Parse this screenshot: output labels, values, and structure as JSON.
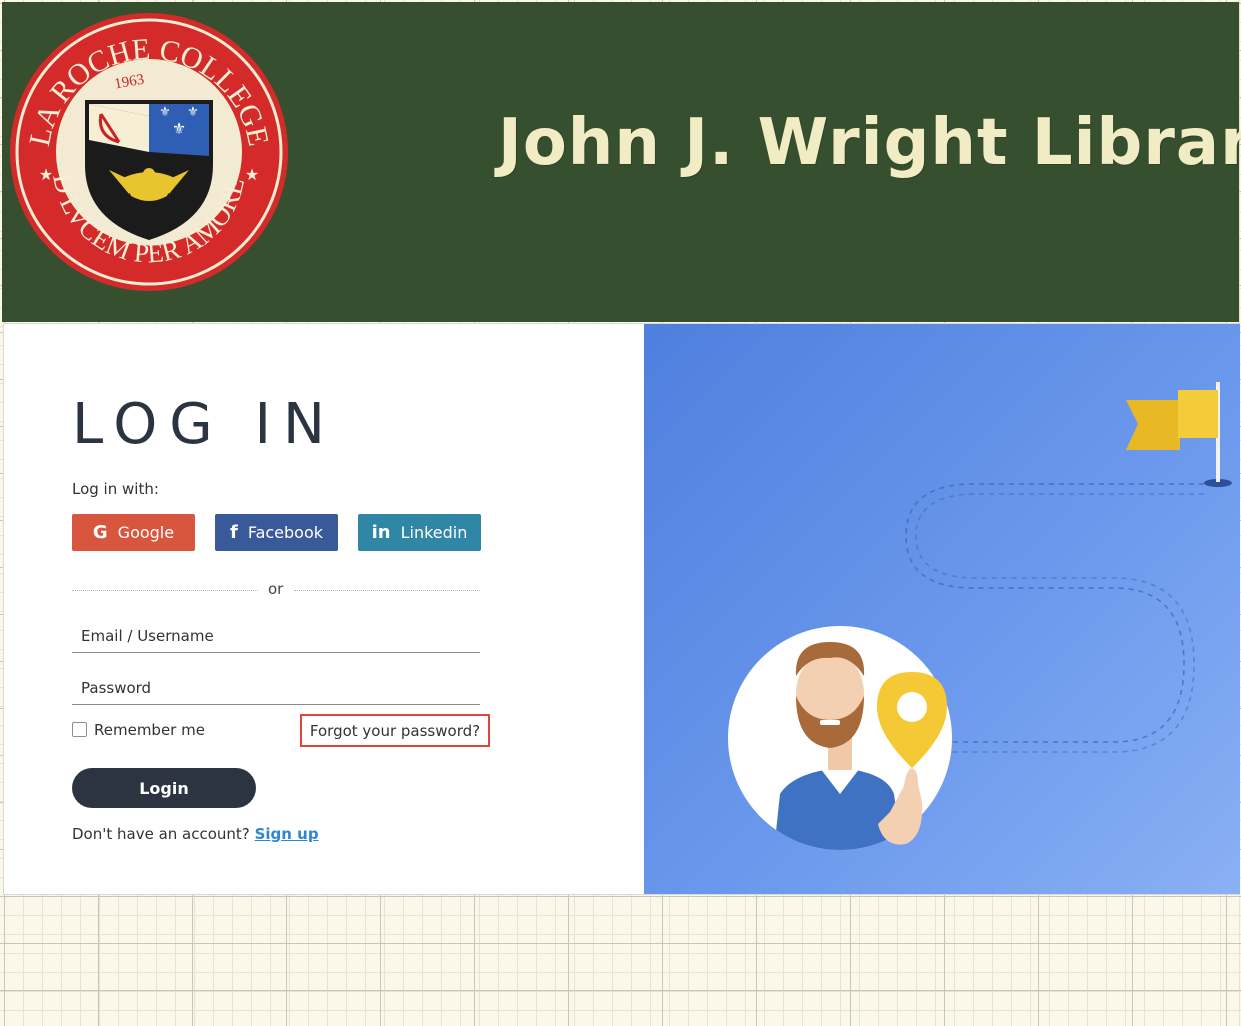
{
  "header": {
    "seal": {
      "text_top": "LA ROCHE COLLEGE",
      "text_bottom": "AD LVCEM PER AMOREM",
      "year": "1963"
    },
    "title": "John J. Wright Library"
  },
  "login": {
    "title": "LOG IN",
    "login_with_label": "Log in with:",
    "social": {
      "google": "Google",
      "facebook": "Facebook",
      "linkedin": "Linkedin"
    },
    "divider_text": "or",
    "email_placeholder": "Email / Username",
    "password_placeholder": "Password",
    "remember_me": "Remember me",
    "forgot_password": "Forgot your password?",
    "login_button": "Login",
    "no_account_text": "Don't have an account?",
    "signup_link": "Sign up"
  },
  "colors": {
    "header_bg": "#364f2f",
    "title_text": "#f2ecc4",
    "google": "#d9563e",
    "facebook": "#3a5998",
    "linkedin": "#2f87a5",
    "login_button": "#2b3440",
    "highlight_border": "#e0463c",
    "signup_link": "#2f87d0",
    "illustration_bg": "#5a88e4"
  }
}
